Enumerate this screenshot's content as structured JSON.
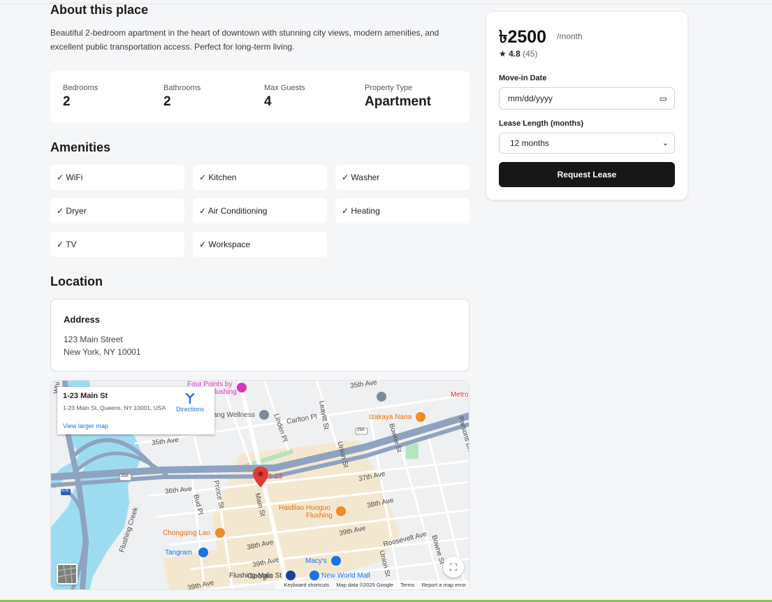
{
  "about": {
    "title": "About this place",
    "description": "Beautiful 2-bedroom apartment in the heart of downtown with stunning city views, modern amenities, and excellent public transportation access. Perfect for long-term living."
  },
  "stats": [
    {
      "label": "Bedrooms",
      "value": "2"
    },
    {
      "label": "Bathrooms",
      "value": "2"
    },
    {
      "label": "Max Guests",
      "value": "4"
    },
    {
      "label": "Property Type",
      "value": "Apartment"
    }
  ],
  "amenities": {
    "title": "Amenities",
    "items": [
      "✓ WiFi",
      "✓ Kitchen",
      "✓ Washer",
      "✓ Dryer",
      "✓ Air Conditioning",
      "✓ Heating",
      "✓ TV",
      "✓ Workspace"
    ]
  },
  "location": {
    "title": "Location",
    "address_title": "Address",
    "line1": "123 Main Street",
    "line2": "New York, NY 10001"
  },
  "map": {
    "info_title": "1-23 Main St",
    "info_address": "1-23 Main St, Queens, NY 10001, USA",
    "directions": "Directions",
    "view_larger": "View larger map",
    "pin_label": "1-23",
    "streets": [
      "35th Ave",
      "35th Ave",
      "Carlton Pl",
      "Linden Pl",
      "Leavitt St",
      "Union St",
      "Bowne St",
      "Parsons Blvd",
      "37th Ave",
      "36th Ave",
      "Bud Pl",
      "Prince St",
      "Main St",
      "38th Ave",
      "39th Ave",
      "38th Ave",
      "39th Ave",
      "Roosevelt Ave",
      "Bowne St",
      "Union St",
      "39th Ave",
      "Flushing Creek",
      "Whi"
    ],
    "shields": [
      "25A",
      "25A",
      "678"
    ],
    "pois": {
      "four_points": "Four Points by",
      "four_points_2": "Flushing",
      "wellness": "ang Wellness",
      "izakaya": "Izakaya Nana",
      "metro": "Metro",
      "haidilao": "Haidilao Huoguo",
      "haidilao_2": "Flushing",
      "chongqing": "Chongqing Lao",
      "tangram": "Tangram",
      "macys": "Macy's",
      "new_world": "New World Mall",
      "flushing_main": "Flushing-Main St"
    },
    "google": "Google",
    "attribution": [
      "Keyboard shortcuts",
      "Map data ©2025 Google",
      "Terms",
      "Report a map error"
    ]
  },
  "booking": {
    "price": "৳2500",
    "per": "/month",
    "rating": "4.8",
    "reviews": "(45)",
    "movein_label": "Move-in Date",
    "date_placeholder": "mm/dd/yyyy",
    "lease_label": "Lease Length (months)",
    "lease_value": "12 months",
    "button": "Request Lease"
  },
  "colors": {
    "button_bg": "#171717",
    "map_water": "#9ddcf0",
    "map_highway": "#8fa3c0",
    "map_shade": "#f3e8cf",
    "pin": "#e53935",
    "footer_rule": "#8bc34a"
  },
  "icons": [
    "star-icon",
    "calendar-icon",
    "chevron-down-icon",
    "map-pin-icon",
    "directions-icon",
    "fullscreen-icon"
  ]
}
